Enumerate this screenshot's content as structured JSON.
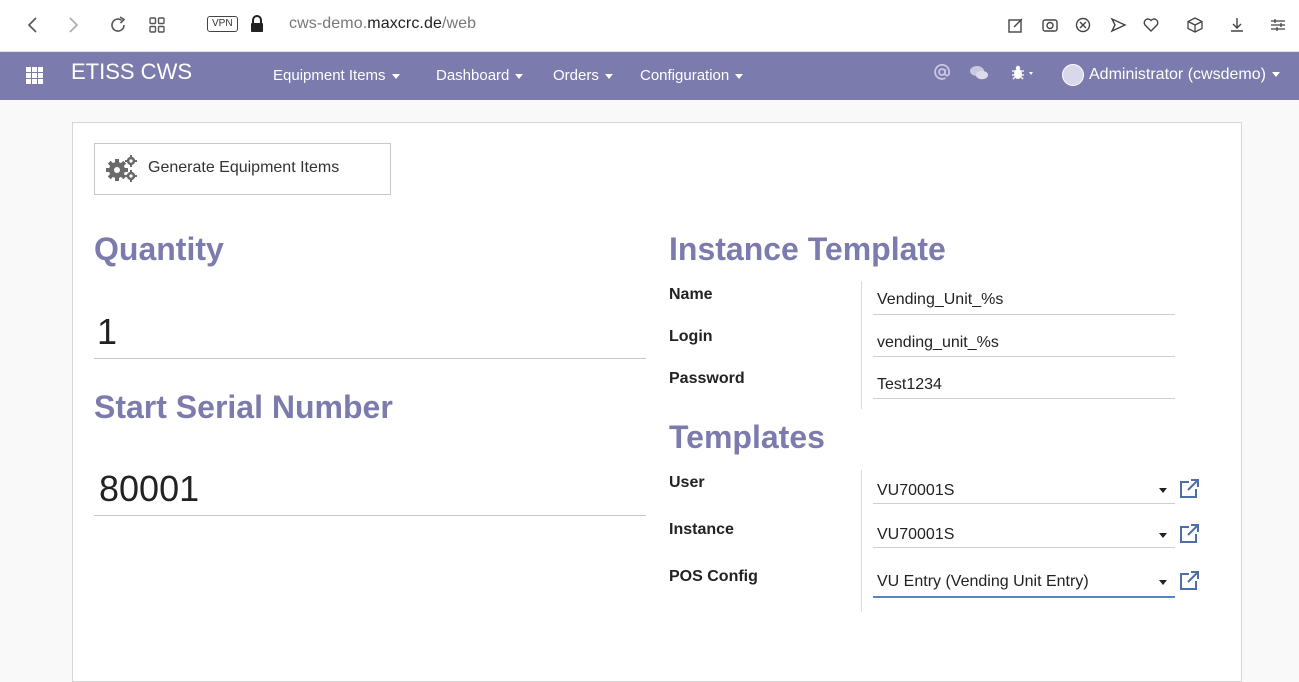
{
  "browser": {
    "vpn_label": "VPN",
    "url_prefix": "cws-demo.",
    "url_host": "maxcrc.de",
    "url_path": "/web"
  },
  "navbar": {
    "brand": "ETISS CWS",
    "menus": [
      {
        "label": "Equipment Items"
      },
      {
        "label": "Dashboard"
      },
      {
        "label": "Orders"
      },
      {
        "label": "Configuration"
      }
    ],
    "user": "Administrator (cwsdemo)"
  },
  "form": {
    "generate_button": "Generate Equipment Items",
    "quantity": {
      "heading": "Quantity",
      "value": "1"
    },
    "serial": {
      "heading": "Start Serial Number",
      "value": "80001"
    },
    "instance_template": {
      "heading": "Instance Template",
      "name_label": "Name",
      "name_value": "Vending_Unit_%s",
      "login_label": "Login",
      "login_value": "vending_unit_%s",
      "password_label": "Password",
      "password_value": "Test1234"
    },
    "templates": {
      "heading": "Templates",
      "user_label": "User",
      "user_value": "VU70001S",
      "instance_label": "Instance",
      "instance_value": "VU70001S",
      "pos_label": "POS Config",
      "pos_value": "VU Entry (Vending Unit Entry)"
    }
  },
  "colors": {
    "accent": "#7c7bad",
    "focus": "#5b84c4"
  }
}
